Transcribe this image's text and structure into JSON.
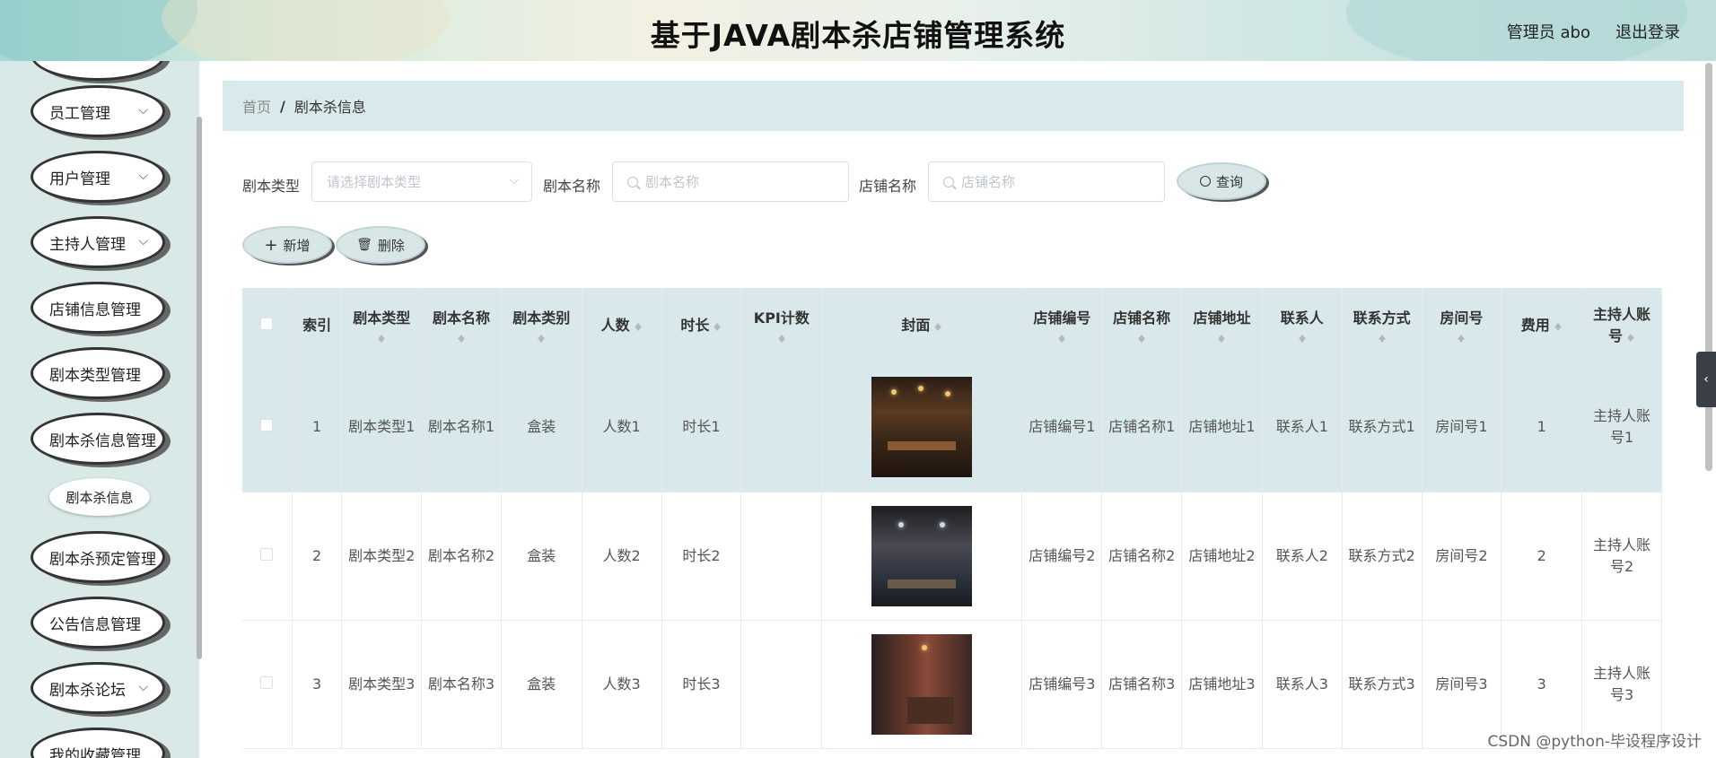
{
  "header": {
    "title": "基于JAVA剧本杀店铺管理系统",
    "user": "管理员 abo",
    "logout": "退出登录"
  },
  "sidebar": {
    "items": [
      {
        "label": "员工管理",
        "has_chevron": true
      },
      {
        "label": "用户管理",
        "has_chevron": true
      },
      {
        "label": "主持人管理",
        "has_chevron": true
      },
      {
        "label": "店铺信息管理",
        "has_chevron": true
      },
      {
        "label": "剧本类型管理",
        "has_chevron": true
      },
      {
        "label": "剧本杀信息管理",
        "has_chevron": true
      },
      {
        "label": "剧本杀预定管理",
        "has_chevron": true
      },
      {
        "label": "公告信息管理",
        "has_chevron": true
      },
      {
        "label": "剧本杀论坛",
        "has_chevron": true
      },
      {
        "label": "我的收藏管理",
        "has_chevron": true
      }
    ],
    "active_sub": "剧本杀信息"
  },
  "breadcrumb": {
    "home": "首页",
    "separator": "/",
    "current": "剧本杀信息"
  },
  "search": {
    "type_label": "剧本类型",
    "type_placeholder": "请选择剧本类型",
    "name_label": "剧本名称",
    "name_placeholder": "剧本名称",
    "shop_label": "店铺名称",
    "shop_placeholder": "店铺名称",
    "query_button": "查询"
  },
  "actions": {
    "add": "新增",
    "delete": "删除"
  },
  "table": {
    "columns": [
      "索引",
      "剧本类型",
      "剧本名称",
      "剧本类别",
      "人数",
      "时长",
      "KPI计数",
      "封面",
      "店铺编号",
      "店铺名称",
      "店铺地址",
      "联系人",
      "联系方式",
      "房间号",
      "费用",
      "主持人账号"
    ],
    "rows": [
      {
        "index": "1",
        "type": "剧本类型1",
        "name": "剧本名称1",
        "category": "盒装",
        "people": "人数1",
        "duration": "时长1",
        "kpi": "",
        "shop_no": "店铺编号1",
        "shop_name": "店铺名称1",
        "shop_addr": "店铺地址1",
        "contact": "联系人1",
        "phone": "联系方式1",
        "room": "房间号1",
        "fee": "1",
        "host": "主持人账号1"
      },
      {
        "index": "2",
        "type": "剧本类型2",
        "name": "剧本名称2",
        "category": "盒装",
        "people": "人数2",
        "duration": "时长2",
        "kpi": "",
        "shop_no": "店铺编号2",
        "shop_name": "店铺名称2",
        "shop_addr": "店铺地址2",
        "contact": "联系人2",
        "phone": "联系方式2",
        "room": "房间号2",
        "fee": "2",
        "host": "主持人账号2"
      },
      {
        "index": "3",
        "type": "剧本类型3",
        "name": "剧本名称3",
        "category": "盒装",
        "people": "人数3",
        "duration": "时长3",
        "kpi": "",
        "shop_no": "店铺编号3",
        "shop_name": "店铺名称3",
        "shop_addr": "店铺地址3",
        "contact": "联系人3",
        "phone": "联系方式3",
        "room": "房间号3",
        "fee": "3",
        "host": "主持人账号3"
      }
    ]
  },
  "watermark": "CSDN @python-毕设程序设计"
}
